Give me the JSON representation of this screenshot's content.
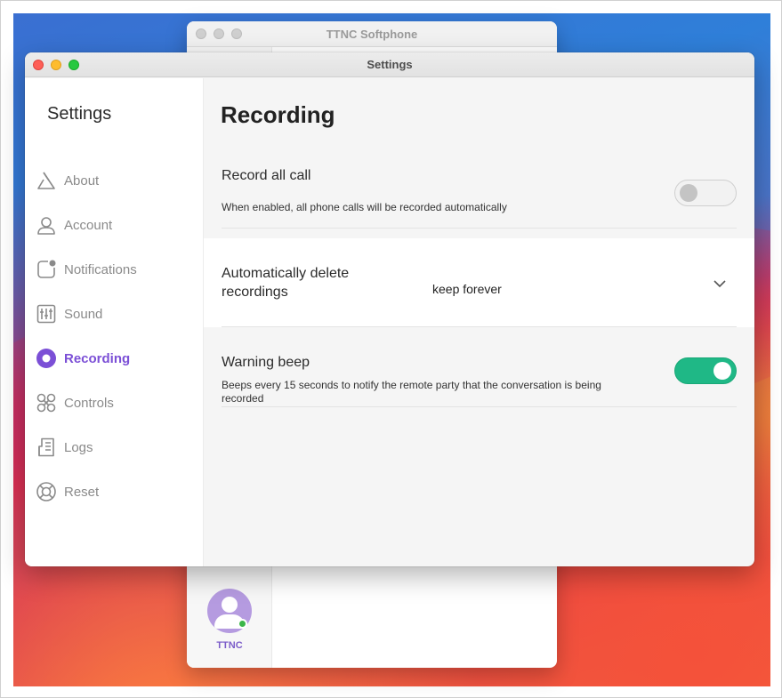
{
  "background_window": {
    "title": "TTNC Softphone",
    "user_name": "TTNC"
  },
  "settings_window": {
    "title": "Settings",
    "sidebar": {
      "title": "Settings",
      "items": [
        {
          "label": "About",
          "icon": "about-icon"
        },
        {
          "label": "Account",
          "icon": "account-icon"
        },
        {
          "label": "Notifications",
          "icon": "notifications-icon"
        },
        {
          "label": "Sound",
          "icon": "sound-icon"
        },
        {
          "label": "Recording",
          "icon": "recording-icon",
          "active": true
        },
        {
          "label": "Controls",
          "icon": "controls-icon"
        },
        {
          "label": "Logs",
          "icon": "logs-icon"
        },
        {
          "label": "Reset",
          "icon": "reset-icon"
        }
      ]
    },
    "page": {
      "title": "Recording",
      "record_all": {
        "title": "Record all call",
        "description": "When enabled, all phone calls will be recorded automatically",
        "enabled": false
      },
      "auto_delete": {
        "title": "Automatically delete recordings",
        "value": "keep forever"
      },
      "warning_beep": {
        "title": "Warning beep",
        "description": "Beeps every 15 seconds to notify the remote party that the conversation is being recorded",
        "enabled": true
      }
    },
    "colors": {
      "accent": "#7b4fd6",
      "toggle_on": "#1fb886",
      "inactive_text": "#8a8a8a"
    }
  }
}
